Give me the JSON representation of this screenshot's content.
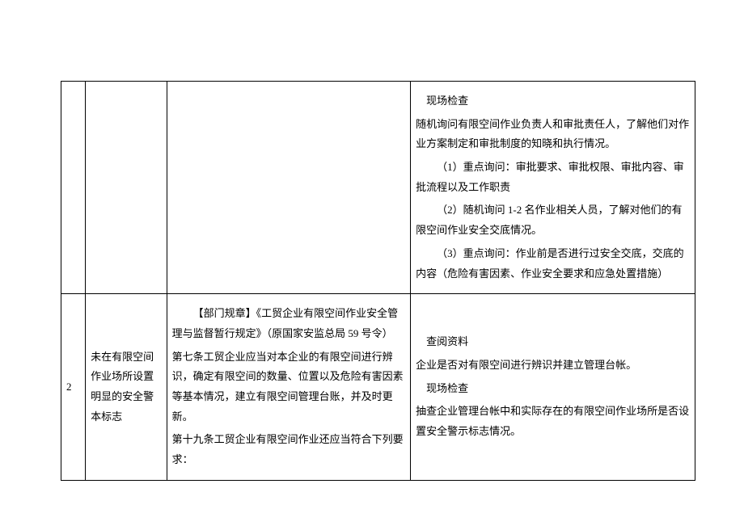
{
  "rows": [
    {
      "idx": "",
      "item": "",
      "basis": "",
      "method": {
        "p1": "现场检查",
        "p2": "随机询问有限空间作业负责人和审批责任人，了解他们对作业方案制定和审批制度的知晓和执行情况。",
        "p3": "（1）重点询问：审批要求、审批权限、审批内容、审批流程以及工作职责",
        "p4": "（2）随机询问 1-2 名作业相关人员，了解对他们的有限空间作业安全交底情况。",
        "p5": "（3）重点询问：作业前是否进行过安全交底，交底的内容（危险有害因素、作业安全要求和应急处置措施）"
      }
    },
    {
      "idx": "2",
      "item": "未在有限空间作业场所设置明显的安全警本标志",
      "basis": {
        "p1": "【部门规章】《工贸企业有限空间作业安全管理与监督暂行规定》（原国家安监总局 59 号令）",
        "p2": "第七条工贸企业应当对本企业的有限空间进行辨识，确定有限空间的数量、位置以及危险有害因素等基本情况，建立有限空间管理台账，并及时更新。",
        "p3": "第十九条工贸企业有限空间作业还应当符合下列要求："
      },
      "method": {
        "p1": "查阅资料",
        "p2": "企业是否对有限空间进行辨识并建立管理台帐。",
        "p3": "现场检查",
        "p4": "抽查企业管理台帐中和实际存在的有限空间作业场所是否设置安全警示标志情况。"
      }
    }
  ]
}
